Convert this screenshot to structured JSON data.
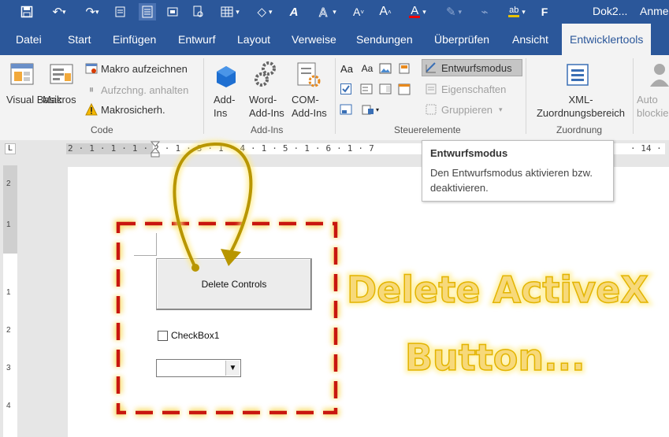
{
  "qat": {
    "doc_title": "Dok2...",
    "signin": "Anme",
    "bold_letter": "F",
    "color_letter": "A"
  },
  "tabs": [
    "Datei",
    "Start",
    "Einfügen",
    "Entwurf",
    "Layout",
    "Verweise",
    "Sendungen",
    "Überprüfen",
    "Ansicht",
    "Entwicklertools"
  ],
  "ribbon": {
    "code": {
      "visual_basic": "Visual Basic",
      "makros": "Makros",
      "makro_aufzeichnen": "Makro aufzeichnen",
      "aufzeichnung_anhalten": "Aufzchng. anhalten",
      "makrosicherheit": "Makrosicherh.",
      "group": "Code"
    },
    "addins": {
      "add_ins": "Add-Ins",
      "word_add_ins": "Word-Add-Ins",
      "com_add_ins": "COM-Add-Ins",
      "group": "Add-Ins"
    },
    "controls": {
      "entwurfsmodus": "Entwurfsmodus",
      "eigenschaften": "Eigenschaften",
      "gruppieren": "Gruppieren",
      "group": "Steuerelemente"
    },
    "mapping": {
      "xml": "XML-Zuordnungsbereich",
      "group": "Zuordnung"
    },
    "protect": {
      "label": "Auto blockie"
    }
  },
  "tooltip": {
    "title": "Entwurfsmodus",
    "description": "Den Entwurfsmodus aktivieren bzw. deaktivieren."
  },
  "ruler": {
    "horizontal": "2 · 1 · 1 · 1 · 2 · 1 · 3 · 1 · 4 · 1 · 5 · 1 · 6 · 1 · 7",
    "right_end": "· 14 ·"
  },
  "document": {
    "button_label": "Delete Controls",
    "checkbox_label": "CheckBox1"
  },
  "overlay": {
    "line1": "Delete ActiveX",
    "line2": "Button..."
  },
  "colors": {
    "word_blue": "#2b579a",
    "highlight_dash": "#c8160f",
    "glow": "#f5c400",
    "arrow": "#b89600"
  }
}
